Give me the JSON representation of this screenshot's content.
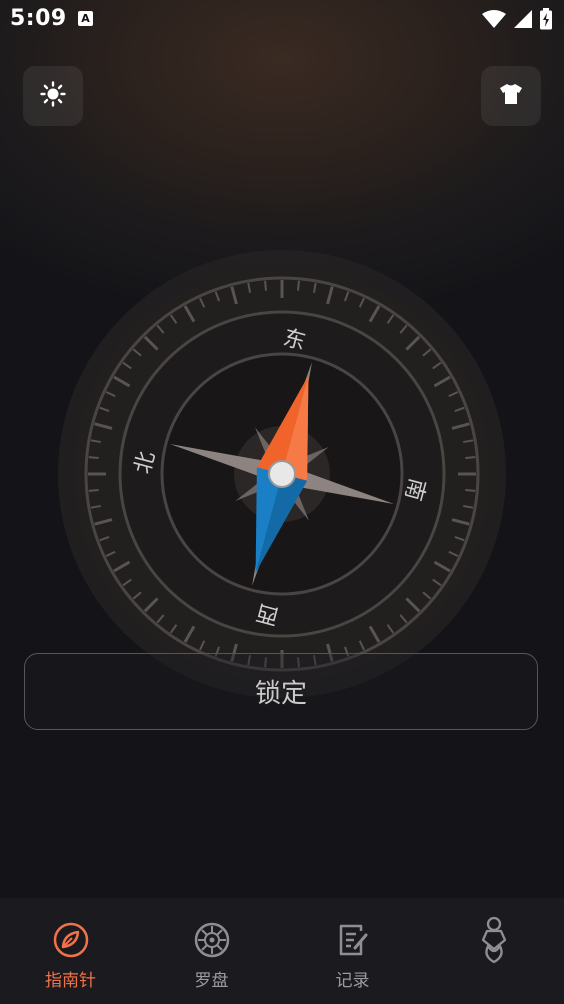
{
  "status_bar": {
    "time": "5:09",
    "notification_badge": "A"
  },
  "top_bar": {
    "left_icon": "brightness-icon",
    "right_icon": "tshirt-icon"
  },
  "compass": {
    "direction_labels": {
      "east": "东",
      "south": "南",
      "west": "西",
      "north": "北"
    },
    "needle_colors": {
      "north": "#f0642c",
      "south": "#1a7fc4"
    }
  },
  "lock_button": {
    "label": "锁定"
  },
  "bottom_nav": {
    "items": [
      {
        "label": "指南针",
        "icon": "compass-leaf-icon",
        "active": true
      },
      {
        "label": "罗盘",
        "icon": "compass-wheel-icon",
        "active": false
      },
      {
        "label": "记录",
        "icon": "note-edit-icon",
        "active": false
      },
      {
        "label": "",
        "icon": "character-icon",
        "active": false
      }
    ],
    "accent_color": "#f0734a"
  }
}
